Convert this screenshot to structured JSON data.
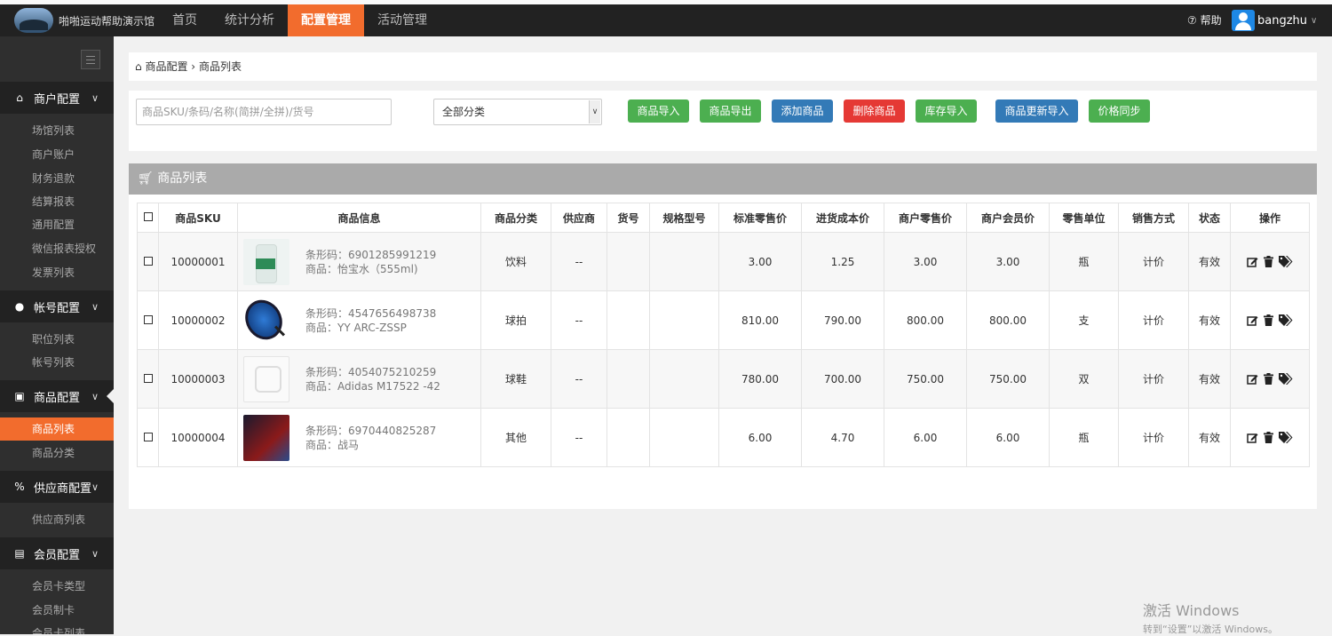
{
  "app": {
    "brand": "啪啪运动帮助演示馆"
  },
  "topnav": {
    "items": [
      {
        "label": "首页"
      },
      {
        "label": "统计分析"
      },
      {
        "label": "配置管理"
      },
      {
        "label": "活动管理"
      }
    ],
    "help": "帮助",
    "user": "bangzhu"
  },
  "sidebar": {
    "groups": [
      {
        "label": "商户配置",
        "items": [
          "场馆列表",
          "商户账户",
          "财务退款",
          "结算报表",
          "通用配置",
          "微信报表授权",
          "发票列表"
        ]
      },
      {
        "label": "帐号配置",
        "items": [
          "职位列表",
          "帐号列表"
        ]
      },
      {
        "label": "商品配置",
        "items": [
          "商品列表",
          "商品分类"
        ]
      },
      {
        "label": "供应商配置",
        "items": [
          "供应商列表"
        ]
      },
      {
        "label": "会员配置",
        "items": [
          "会员卡类型",
          "会员制卡",
          "会员卡列表"
        ]
      }
    ]
  },
  "breadcrumb": {
    "parent": "商品配置",
    "sep": "›",
    "current": "商品列表"
  },
  "toolbar": {
    "search_placeholder": "商品SKU/条码/名称(简拼/全拼)/货号",
    "category_select": "全部分类",
    "buttons": [
      "商品导入",
      "商品导出",
      "添加商品",
      "删除商品",
      "库存导入",
      "商品更新导入",
      "价格同步"
    ]
  },
  "panel": {
    "title": "商品列表"
  },
  "table": {
    "headers": [
      "商品SKU",
      "商品信息",
      "商品分类",
      "供应商",
      "货号",
      "规格型号",
      "标准零售价",
      "进货成本价",
      "商户零售价",
      "商户会员价",
      "零售单位",
      "销售方式",
      "状态",
      "操作"
    ],
    "rows": [
      {
        "sku": "10000001",
        "barcode": "条形码：6901285991219",
        "name": "商品：怡宝水（555ml)",
        "category": "饮料",
        "supplier": "--",
        "item_no": "",
        "spec": "",
        "std_price": "3.00",
        "cost": "1.25",
        "retail": "3.00",
        "member": "3.00",
        "unit": "瓶",
        "sale_mode": "计价",
        "status": "有效"
      },
      {
        "sku": "10000002",
        "barcode": "条形码：4547656498738",
        "name": "商品：YY ARC-ZSSP",
        "category": "球拍",
        "supplier": "--",
        "item_no": "",
        "spec": "",
        "std_price": "810.00",
        "cost": "790.00",
        "retail": "800.00",
        "member": "800.00",
        "unit": "支",
        "sale_mode": "计价",
        "status": "有效"
      },
      {
        "sku": "10000003",
        "barcode": "条形码：4054075210259",
        "name": "商品：Adidas M17522 -42",
        "category": "球鞋",
        "supplier": "--",
        "item_no": "",
        "spec": "",
        "std_price": "780.00",
        "cost": "700.00",
        "retail": "750.00",
        "member": "750.00",
        "unit": "双",
        "sale_mode": "计价",
        "status": "有效"
      },
      {
        "sku": "10000004",
        "barcode": "条形码：6970440825287",
        "name": "商品：战马",
        "category": "其他",
        "supplier": "--",
        "item_no": "",
        "spec": "",
        "std_price": "6.00",
        "cost": "4.70",
        "retail": "6.00",
        "member": "6.00",
        "unit": "瓶",
        "sale_mode": "计价",
        "status": "有效"
      }
    ]
  },
  "watermark": {
    "line1": "激活 Windows",
    "line2": "转到“设置”以激活 Windows。"
  },
  "colors": {
    "accent": "#f26c2d",
    "nav_bg": "#222222",
    "sidebar_bg": "#2f2f2f",
    "green": "#4caf50",
    "blue": "#337ab7",
    "red": "#e53935"
  }
}
